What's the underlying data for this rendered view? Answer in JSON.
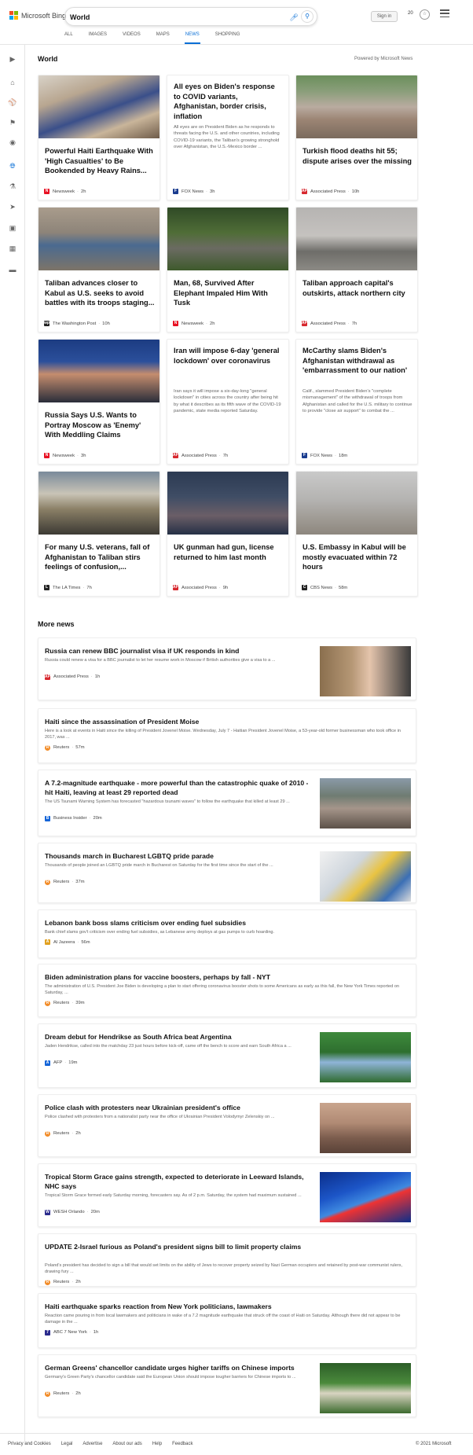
{
  "header": {
    "logo_text": "Microsoft Bing",
    "search_value": "World",
    "signin_label": "Sign in",
    "rewards_points": "20"
  },
  "nav": {
    "tabs": [
      "ALL",
      "IMAGES",
      "VIDEOS",
      "MAPS",
      "NEWS",
      "SHOPPING"
    ],
    "active": "NEWS"
  },
  "sidebar": {
    "icons": [
      "expand-icon",
      "home-icon",
      "sports-icon",
      "flag-icon",
      "location-icon",
      "world-icon",
      "science-icon",
      "rocket-icon",
      "entertainment-icon",
      "building-icon",
      "money-icon"
    ]
  },
  "section": {
    "title": "World",
    "powered_by": "Powered by Microsoft News"
  },
  "cards": [
    {
      "title": "Powerful Haiti Earthquake With 'High Casualties' to Be Bookended by Heavy Rains...",
      "source": "Newsweek",
      "time": "2h",
      "icon": "N",
      "icon_color": "#e81123",
      "image": "protest-signs"
    },
    {
      "title": "All eyes on Biden's response to COVID variants, Afghanistan, border crisis, inflation",
      "desc": "All eyes are on President Biden as he responds to threats facing the U.S. and other countries, including COVID-19 variants, the Taliban's growing stronghold over Afghanistan, the U.S.-Mexico border ...",
      "source": "FOX News",
      "time": "3h",
      "icon": "F",
      "icon_color": "#1a3c8f"
    },
    {
      "title": "Turkish flood deaths hit 55; dispute arises over the missing",
      "source": "Associated Press",
      "time": "10h",
      "icon": "AP",
      "icon_color": "#d7282f",
      "image": "flood-ruins"
    },
    {
      "title": "Taliban advances closer to Kabul as U.S. seeks to avoid battles with its troops staging...",
      "source": "The Washington Post",
      "time": "10h",
      "icon": "wp",
      "icon_color": "#222",
      "image": "burqa-women"
    },
    {
      "title": "Man, 68, Survived After Elephant Impaled Him With Tusk",
      "source": "Newsweek",
      "time": "2h",
      "icon": "N",
      "icon_color": "#e81123",
      "image": "elephant"
    },
    {
      "title": "Taliban approach capital's outskirts, attack northern city",
      "source": "Associated Press",
      "time": "7h",
      "icon": "AP",
      "icon_color": "#d7282f",
      "image": "hazy-city"
    },
    {
      "title": "Russia Says U.S. Wants to Portray Moscow as 'Enemy' With Meddling Claims",
      "source": "Newsweek",
      "time": "3h",
      "icon": "N",
      "icon_color": "#e81123",
      "image": "diplomat"
    },
    {
      "title": "Iran will impose 6-day 'general lockdown' over coronavirus",
      "desc": "Iran says it will impose a six-day-long \"general lockdown\" in cities across the country after being hit by what it describes as its fifth wave of the COVID-19 pandemic, state media reported Saturday.",
      "source": "Associated Press",
      "time": "7h",
      "icon": "AP",
      "icon_color": "#d7282f"
    },
    {
      "title": "McCarthy slams Biden's Afghanistan withdrawal as 'embarrassment to our nation'",
      "desc": "Calif., slammed President Biden's \"complete mismanagement\" of the withdrawal of troops from Afghanistan and called for the U.S. military to continue to provide \"close air support\" to combat the ...",
      "source": "FOX News",
      "time": "18m",
      "icon": "F",
      "icon_color": "#1a3c8f"
    },
    {
      "title": "For many U.S. veterans, fall of Afghanistan to Taliban stirs feelings of confusion,...",
      "source": "The LA Times",
      "time": "7h",
      "icon": "L",
      "icon_color": "#222",
      "image": "soldiers-truck"
    },
    {
      "title": "UK gunman had gun, license returned to him last month",
      "source": "Associated Press",
      "time": "9h",
      "icon": "AP",
      "icon_color": "#d7282f",
      "image": "vigil-crowd"
    },
    {
      "title": "U.S. Embassy in Kabul will be mostly evacuated within 72 hours",
      "source": "CBS News",
      "time": "58m",
      "icon": "C",
      "icon_color": "#222",
      "image": "hazy-hills"
    }
  ],
  "more_news": {
    "title": "More news",
    "items": [
      {
        "title": "Russia can renew BBC journalist visa if UK responds in kind",
        "desc": "Russia could renew a visa for a BBC journalist to let her resume work in Moscow if British authorities give a visa to a ...",
        "source": "Associated Press",
        "time": "1h",
        "icon": "AP",
        "icon_color": "#d7282f",
        "image": "journalist-portrait"
      },
      {
        "title": "Haiti since the assassination of President Moise",
        "desc": "Here is a look at events in Haiti since the killing of President Jovenel Moise. Wednesday, July 7 - Haitian President Jovenel Moise, a 53-year-old former businessman who took office in 2017, was ...",
        "source": "Reuters",
        "time": "57m",
        "icon": "R",
        "icon_color": "#f28c28"
      },
      {
        "title": "A 7.2-magnitude earthquake - more powerful than the catastrophic quake of 2010 - hit Haiti, leaving at least 29 reported dead",
        "desc": "The US Tsunami Warning System has forecasted \"hazardous tsunami waves\" to follow the earthquake that killed at least 29 ...",
        "source": "Business Insider",
        "time": "20m",
        "icon": "B",
        "icon_color": "#1565d8",
        "image": "quake-street"
      },
      {
        "title": "Thousands march in Bucharest LGBTQ pride parade",
        "desc": "Thousands of people joined an LGBTQ pride march in Bucharest on Saturday for the first time since the start of the ...",
        "source": "Reuters",
        "time": "37m",
        "icon": "R",
        "icon_color": "#f28c28",
        "image": "pride-mask"
      },
      {
        "title": "Lebanon bank boss slams criticism over ending fuel subsidies",
        "desc": "Bank chief slams gov't criticism over ending fuel subsidies, as Lebanese army deploys at gas pumps to curb hoarding.",
        "source": "Al Jazeera",
        "time": "56m",
        "icon": "A",
        "icon_color": "#e0a020"
      },
      {
        "title": "Biden administration plans for vaccine boosters, perhaps by fall - NYT",
        "desc": "The administration of U.S. President Joe Biden is developing a plan to start offering coronavirus booster shots to some Americans as early as this fall, the New York Times reported on Saturday, ...",
        "source": "Reuters",
        "time": "39m",
        "icon": "R",
        "icon_color": "#f28c28"
      },
      {
        "title": "Dream debut for Hendrikse as South Africa beat Argentina",
        "desc": "Jaden Hendrikse, called into the matchday 23 just hours before kick-off, came off the bench to score and earn South Africa a ...",
        "source": "AFP",
        "time": "19m",
        "icon": "A",
        "icon_color": "#1565d8",
        "image": "rugby"
      },
      {
        "title": "Police clash with protesters near Ukrainian president's office",
        "desc": "Police clashed with protesters from a nationalist party near the office of Ukrainian President Volodymyr Zelenskiy on ...",
        "source": "Reuters",
        "time": "2h",
        "icon": "R",
        "icon_color": "#f28c28",
        "image": "smoke-clash"
      },
      {
        "title": "Tropical Storm Grace gains strength, expected to deteriorate in Leeward Islands, NHC says",
        "desc": "Tropical Storm Grace formed early Saturday morning, forecasters say. As of 2 p.m. Saturday, the system had maximum sustained ...",
        "source": "WESH Orlando",
        "time": "20m",
        "icon": "W",
        "icon_color": "#2a2a8c",
        "image": "storm-map"
      },
      {
        "title": "UPDATE 2-Israel furious as Poland's president signs bill to limit property claims",
        "desc": "Poland's president has decided to sign a bill that would set limits on the ability of Jews to recover property seized by Nazi German occupiers and retained by post-war communist rulers, drawing fury ...",
        "source": "Reuters",
        "time": "2h",
        "icon": "R",
        "icon_color": "#f28c28"
      },
      {
        "title": "Haiti earthquake sparks reaction from New York politicians, lawmakers",
        "desc": "Reaction came pouring in from local lawmakers and politicians in wake of a 7.2 magnitude earthquake that struck off the coast of Haiti on Saturday. Although there did not appear to be damage in the ...",
        "source": "ABC 7 New York",
        "time": "1h",
        "icon": "7",
        "icon_color": "#2a2a8c"
      },
      {
        "title": "German Greens' chancellor candidate urges higher tariffs on Chinese imports",
        "desc": "Germany's Green Party's chancellor candidate said the European Union should impose tougher barriers for Chinese imports to ...",
        "source": "Reuters",
        "time": "2h",
        "icon": "R",
        "icon_color": "#f28c28",
        "image": "podium-speaker"
      }
    ]
  },
  "footer": {
    "links": [
      "Privacy and Cookies",
      "Legal",
      "Advertise",
      "About our ads",
      "Help",
      "Feedback"
    ],
    "copyright": "© 2021 Microsoft"
  },
  "colors": {
    "accent": "#0a6fd6"
  }
}
